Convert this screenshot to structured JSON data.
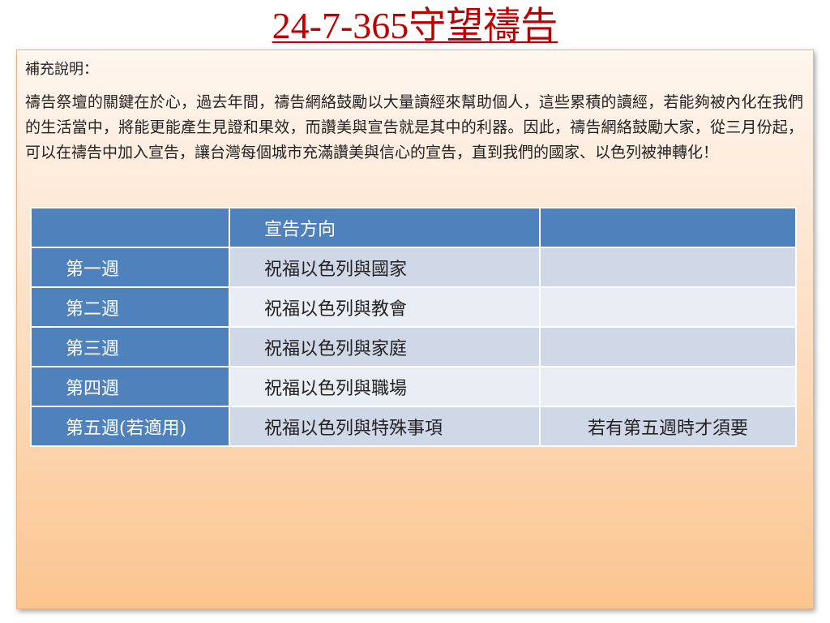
{
  "title": "24-7-365守望禱告",
  "note": {
    "label": "補充說明：",
    "body": "禱告祭壇的關鍵在於心，過去年間，禱告網絡鼓勵以大量讀經來幫助個人，這些累積的讀經，若能夠被內化在我們的生活當中，將能更能產生見證和果效，而讚美與宣告就是其中的利器。因此，禱告網絡鼓勵大家，從三月份起，可以在禱告中加入宣告，讓台灣每個城市充滿讚美與信心的宣告，直到我們的國家、以色列被神轉化！"
  },
  "table": {
    "headers": [
      "",
      "宣告方向",
      ""
    ],
    "rows": [
      {
        "week": "第一週",
        "direction": "祝福以色列與國家",
        "note": ""
      },
      {
        "week": "第二週",
        "direction": "祝福以色列與教會",
        "note": ""
      },
      {
        "week": "第三週",
        "direction": "祝福以色列與家庭",
        "note": ""
      },
      {
        "week": "第四週",
        "direction": "祝福以色列與職場",
        "note": ""
      },
      {
        "week": "第五週(若適用)",
        "direction": "祝福以色列與特殊事項",
        "note": "若有第五週時才須要"
      }
    ]
  },
  "colors": {
    "title": "#c00000",
    "header_blue": "#4f81bd",
    "row_band_1": "#d0d8e8",
    "row_band_2": "#e9edf4"
  }
}
